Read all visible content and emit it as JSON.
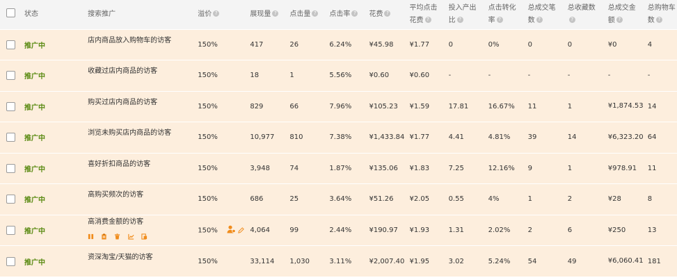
{
  "headers": {
    "status": "状态",
    "audience": "搜索推广",
    "premium": "溢价",
    "impressions": "展现量",
    "clicks": "点击量",
    "ctr": "点击率",
    "cost": "花费",
    "avg_cpc_line1": "平均点击",
    "avg_cpc_line2": "花费",
    "roi_line1": "投入产出",
    "roi_line2": "比",
    "cvr_line1": "点击转化",
    "cvr_line2": "率",
    "orders_line1": "总成交笔",
    "orders_line2": "数",
    "favorites": "总收藏数",
    "gmv_line1": "总成交金",
    "gmv_line2": "额",
    "cart_line1": "总购物车",
    "cart_line2": "数",
    "help_glyph": "?"
  },
  "rows": [
    {
      "status": "推广中",
      "audience": "店内商品放入购物车的访客",
      "premium": "150%",
      "impressions": "417",
      "clicks": "26",
      "ctr": "6.24%",
      "cost": "¥45.98",
      "cpc": "¥1.77",
      "roi": "0",
      "cvr": "0%",
      "orders": "0",
      "favorites": "0",
      "gmv": "¥0",
      "cart": "4"
    },
    {
      "status": "推广中",
      "audience": "收藏过店内商品的访客",
      "premium": "150%",
      "impressions": "18",
      "clicks": "1",
      "ctr": "5.56%",
      "cost": "¥0.60",
      "cpc": "¥0.60",
      "roi": "-",
      "cvr": "-",
      "orders": "-",
      "favorites": "-",
      "gmv": "-",
      "cart": "-"
    },
    {
      "status": "推广中",
      "audience": "购买过店内商品的访客",
      "premium": "150%",
      "impressions": "829",
      "clicks": "66",
      "ctr": "7.96%",
      "cost": "¥105.23",
      "cpc": "¥1.59",
      "roi": "17.81",
      "cvr": "16.67%",
      "orders": "11",
      "favorites": "1",
      "gmv": "¥1,874.53",
      "cart": "14"
    },
    {
      "status": "推广中",
      "audience": "浏览未购买店内商品的访客",
      "premium": "150%",
      "impressions": "10,977",
      "clicks": "810",
      "ctr": "7.38%",
      "cost": "¥1,433.84",
      "cpc": "¥1.77",
      "roi": "4.41",
      "cvr": "4.81%",
      "orders": "39",
      "favorites": "14",
      "gmv": "¥6,323.20",
      "cart": "64"
    },
    {
      "status": "推广中",
      "audience": "喜好折扣商品的访客",
      "premium": "150%",
      "impressions": "3,948",
      "clicks": "74",
      "ctr": "1.87%",
      "cost": "¥135.06",
      "cpc": "¥1.83",
      "roi": "7.25",
      "cvr": "12.16%",
      "orders": "9",
      "favorites": "1",
      "gmv": "¥978.91",
      "cart": "11"
    },
    {
      "status": "推广中",
      "audience": "高购买频次的访客",
      "premium": "150%",
      "impressions": "686",
      "clicks": "25",
      "ctr": "3.64%",
      "cost": "¥51.26",
      "cpc": "¥2.05",
      "roi": "0.55",
      "cvr": "4%",
      "orders": "1",
      "favorites": "2",
      "gmv": "¥28",
      "cart": "8"
    },
    {
      "status": "推广中",
      "audience": "高消费金额的访客",
      "premium": "150%",
      "impressions": "4,064",
      "clicks": "99",
      "ctr": "2.44%",
      "cost": "¥190.97",
      "cpc": "¥1.93",
      "roi": "1.31",
      "cvr": "2.02%",
      "orders": "2",
      "favorites": "6",
      "gmv": "¥250",
      "cart": "13"
    },
    {
      "status": "推广中",
      "audience": "资深淘宝/天猫的访客",
      "premium": "150%",
      "impressions": "33,114",
      "clicks": "1,030",
      "ctr": "3.11%",
      "cost": "¥2,007.40",
      "cpc": "¥1.95",
      "roi": "3.02",
      "cvr": "5.24%",
      "orders": "54",
      "favorites": "49",
      "gmv": "¥6,060.41",
      "cart": "181"
    }
  ],
  "colors": {
    "status_green": "#5a8a12",
    "tool_orange": "#f08c1c",
    "row_bg": "#fdeedd"
  },
  "row_tool_icons": [
    "pause-icon",
    "clipboard-icon",
    "trash-icon",
    "trend-chart-icon",
    "report-icon"
  ],
  "premium_edit_icons": [
    "audience-user-icon",
    "pencil-icon"
  ]
}
